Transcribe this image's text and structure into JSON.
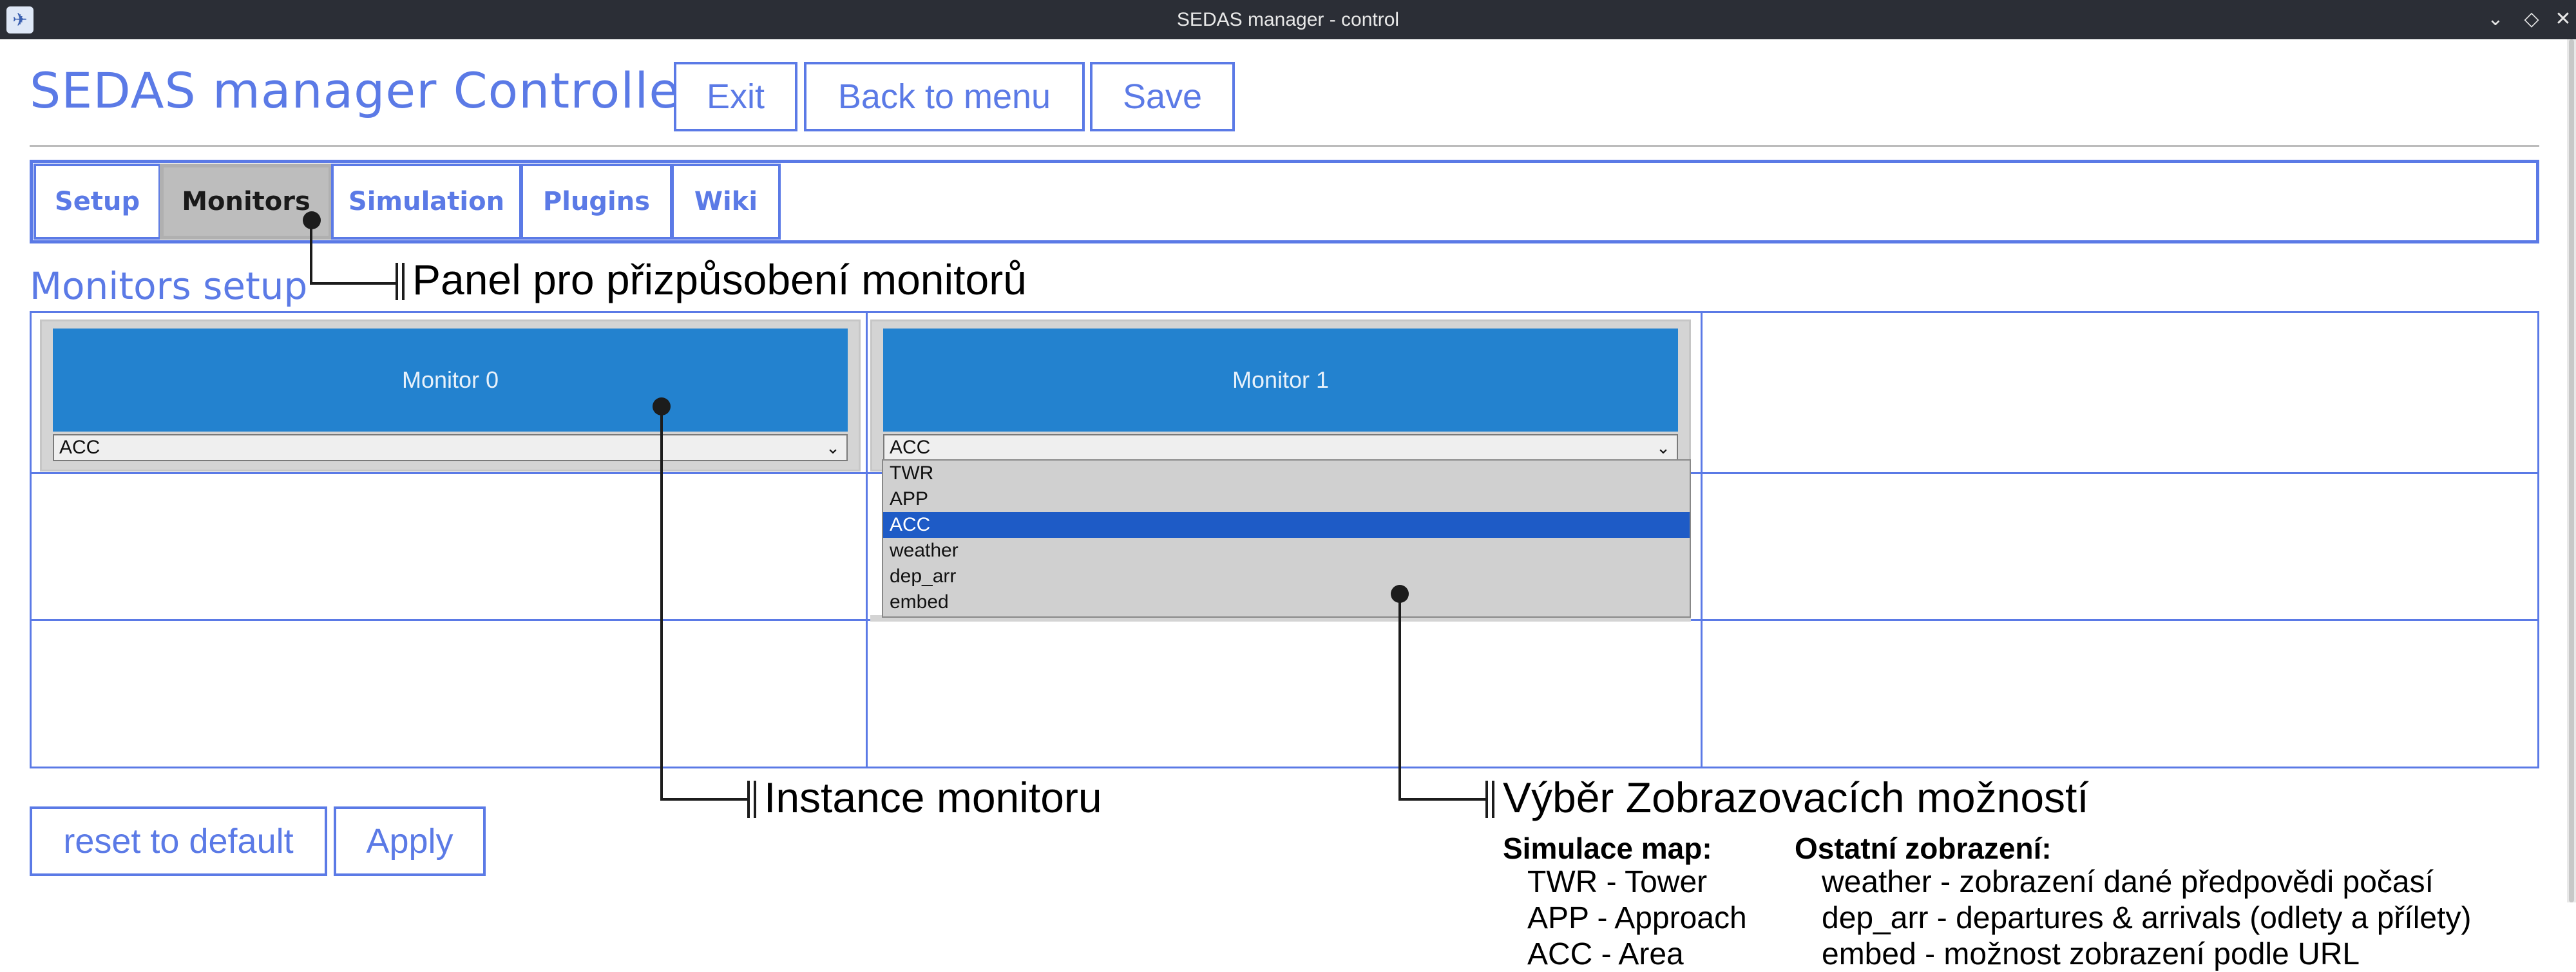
{
  "window": {
    "title": "SEDAS manager - control",
    "icon": "sedas-app-icon",
    "controls": [
      "minimize",
      "maximize",
      "close"
    ]
  },
  "header": {
    "title": "SEDAS manager Controller",
    "buttons": {
      "exit": "Exit",
      "back": "Back to menu",
      "save": "Save"
    }
  },
  "tabs": [
    {
      "label": "Setup",
      "active": false
    },
    {
      "label": "Monitors",
      "active": true
    },
    {
      "label": "Simulation",
      "active": false
    },
    {
      "label": "Plugins",
      "active": false
    },
    {
      "label": "Wiki",
      "active": false
    }
  ],
  "section_title": "Monitors setup",
  "monitors": [
    {
      "name": "Monitor 0",
      "selected": "ACC"
    },
    {
      "name": "Monitor 1",
      "selected": "ACC"
    }
  ],
  "dropdown_options": [
    "TWR",
    "APP",
    "ACC",
    "weather",
    "dep_arr",
    "embed"
  ],
  "dropdown_selected": "ACC",
  "footer_buttons": {
    "reset": "reset to default",
    "apply": "Apply"
  },
  "annotations": {
    "panel": "Panel pro přizpůsobení monitorů",
    "instance": "Instance monitoru",
    "options": "Výběr Zobrazovacích možností"
  },
  "legend": {
    "sim_heading": "Simulace map:",
    "sim_items": [
      "TWR - Tower",
      "APP - Approach",
      "ACC - Area"
    ],
    "other_heading": "Ostatní zobrazení:",
    "other_items": [
      "weather - zobrazení dané předpovědi počasí",
      "dep_arr - departures & arrivals (odlety a přílety)",
      "embed - možnost zobrazení podle URL"
    ]
  },
  "colors": {
    "accent": "#5b7ae6",
    "monitor_header": "#2382cf",
    "titlebar": "#2b2e36",
    "active_tab": "#bdbdbd",
    "dropdown_selected": "#1e5bc6"
  }
}
